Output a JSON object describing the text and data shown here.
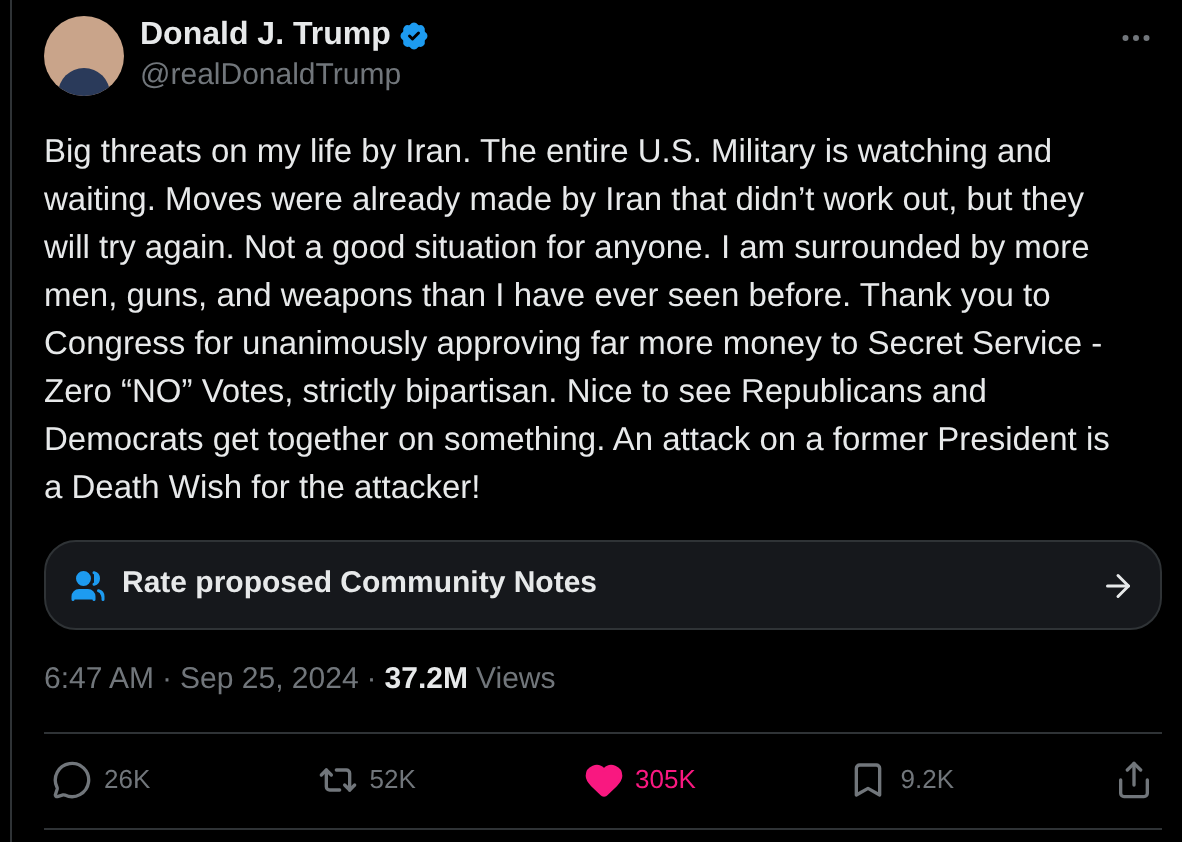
{
  "author": {
    "name": "Donald J. Trump",
    "verified": true,
    "handle": "@realDonaldTrump"
  },
  "text": "Big threats on my life by Iran. The entire U.S. Military is watching and waiting. Moves were already made by Iran that didn’t work out, but they will try again. Not a good situation for anyone. I am surrounded by more men, guns, and weapons than I have ever seen before. Thank you to Congress for unanimously approving far more money to Secret Service - Zero “NO” Votes, strictly bipartisan. Nice to see Republicans and Democrats get together on something. An attack on a former President is a Death Wish for the attacker!",
  "community_notes": {
    "label": "Rate proposed Community Notes"
  },
  "meta": {
    "time": "6:47 AM",
    "separator_1": "·",
    "date": "Sep 25, 2024",
    "separator_2": "·",
    "views_count": "37.2M",
    "views_label": "Views"
  },
  "actions": [
    {
      "kind": "reply",
      "count": "26K",
      "selected": false
    },
    {
      "kind": "repost",
      "count": "52K",
      "selected": false
    },
    {
      "kind": "like",
      "count": "305K",
      "selected": true
    },
    {
      "kind": "bookmark",
      "count": "9.2K",
      "selected": false
    },
    {
      "kind": "share",
      "selected": false
    }
  ]
}
